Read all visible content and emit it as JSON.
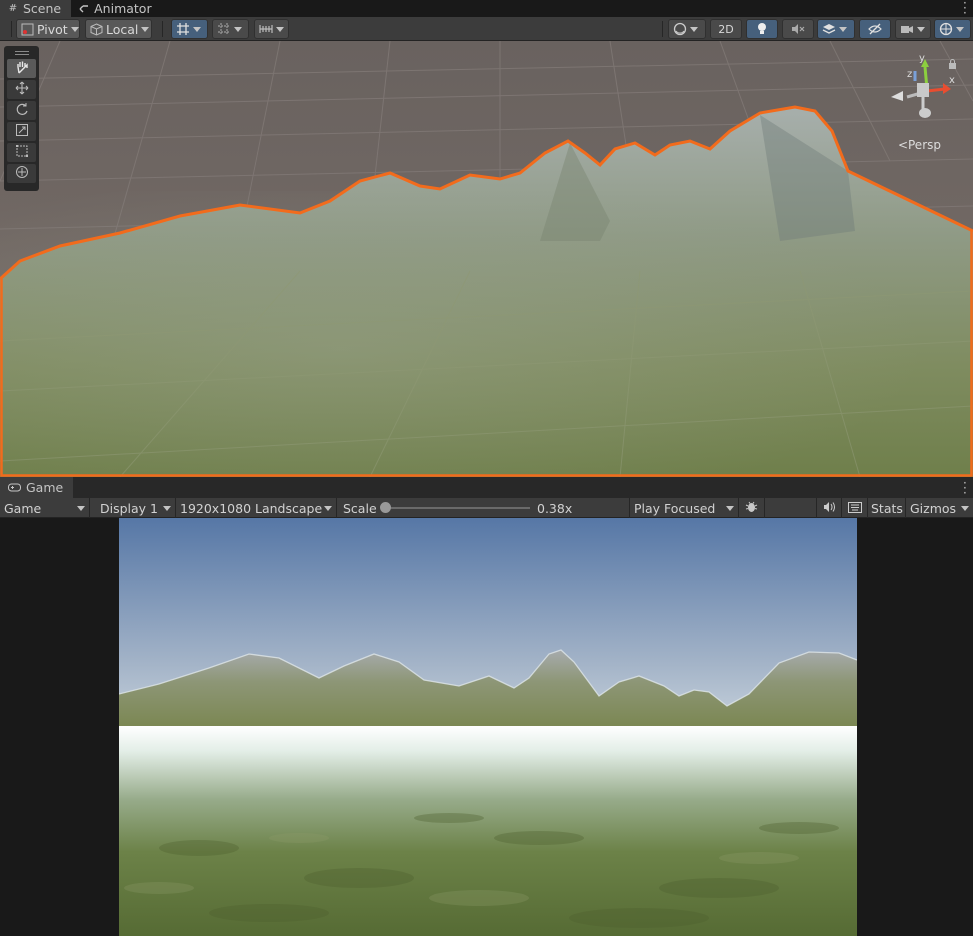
{
  "scene_tabs": [
    {
      "label": "Scene",
      "icon": "hash-icon",
      "active": true
    },
    {
      "label": "Animator",
      "icon": "animator-icon",
      "active": false
    }
  ],
  "scene_toolbar": {
    "pivot_label": "Pivot",
    "local_label": "Local",
    "mode_2d_label": "2D"
  },
  "scene_view": {
    "persp_label": "Persp",
    "gizmo_axes": {
      "x": "x",
      "y": "y",
      "z": "z"
    },
    "tools": [
      "hand-tool",
      "move-tool",
      "rotate-tool",
      "scale-tool",
      "rect-tool",
      "transform-tool"
    ],
    "accent_color": "#f26b1c"
  },
  "game_tab": {
    "label": "Game",
    "icon": "gamepad-icon"
  },
  "game_toolbar": {
    "view_mode": "Game",
    "display": "Display 1",
    "resolution": "1920x1080 Landscape",
    "scale_label": "Scale",
    "scale_value_text": "0.38x",
    "scale_fraction": 0.0,
    "play_mode": "Play Focused",
    "stats_label": "Stats",
    "gizmos_label": "Gizmos"
  },
  "colors": {
    "panel": "#3c3c3c",
    "selection_outline": "#f26b1c",
    "active_blue": "#46607c"
  }
}
